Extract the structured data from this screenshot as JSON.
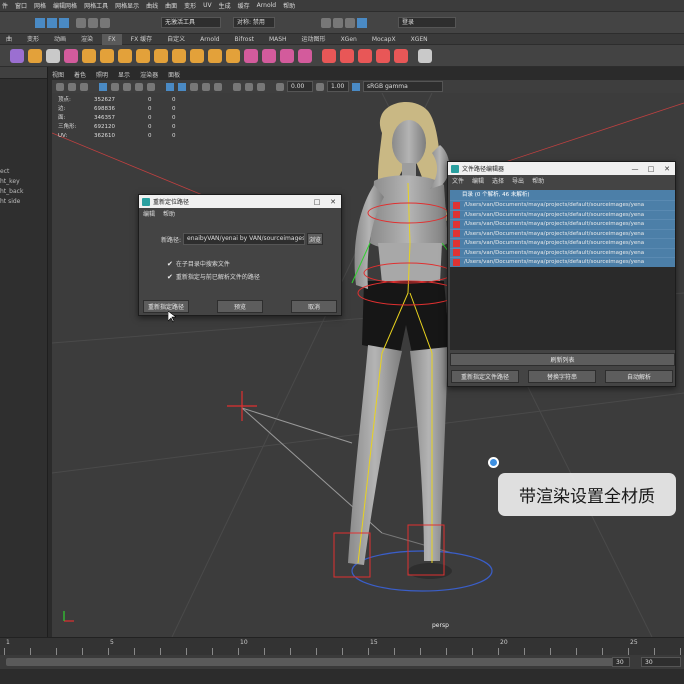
{
  "menubar": [
    "件",
    "窗口",
    "网格",
    "编辑网格",
    "网格工具",
    "网格显示",
    "曲线",
    "曲面",
    "变形",
    "UV",
    "生成",
    "缓存",
    "Arnold",
    "帮助"
  ],
  "statusline": {
    "selection_mode": "无激活工具",
    "symmetry": "对称: 禁用",
    "account": "登录"
  },
  "shelf_tabs": [
    {
      "label": "曲",
      "active": false
    },
    {
      "label": "变形",
      "active": false
    },
    {
      "label": "动画",
      "active": false
    },
    {
      "label": "渲染",
      "active": false
    },
    {
      "label": "FX",
      "active": true
    },
    {
      "label": "FX 缓存",
      "active": false
    },
    {
      "label": "自定义",
      "active": false
    },
    {
      "label": "Arnold",
      "active": false
    },
    {
      "label": "Bifrost",
      "active": false
    },
    {
      "label": "MASH",
      "active": false
    },
    {
      "label": "运动图形",
      "active": false
    },
    {
      "label": "XGen",
      "active": false
    },
    {
      "label": "MocapX",
      "active": false
    },
    {
      "label": "XGEN",
      "active": false
    }
  ],
  "outliner": {
    "items": [
      "ect",
      "ht_key",
      "ht_back",
      "ht side"
    ]
  },
  "viewport_menu": [
    "视图",
    "着色",
    "照明",
    "显示",
    "渲染器",
    "面板"
  ],
  "viewport_toolbar": {
    "field_a": "0.00",
    "field_b": "1.00",
    "color_space": "sRGB gamma"
  },
  "hud": {
    "rows": [
      {
        "k": "顶点:",
        "v1": "352627",
        "v2": "0",
        "v3": "0"
      },
      {
        "k": "边:",
        "v1": "698836",
        "v2": "0",
        "v3": "0"
      },
      {
        "k": "面:",
        "v1": "346357",
        "v2": "0",
        "v3": "0"
      },
      {
        "k": "三角形:",
        "v1": "692120",
        "v2": "0",
        "v3": "0"
      },
      {
        "k": "UV:",
        "v1": "362610",
        "v2": "0",
        "v3": "0"
      }
    ]
  },
  "camera_label": "persp",
  "path_dialog": {
    "title": "重新定位路径",
    "menu": [
      "编辑",
      "帮助"
    ],
    "new_path_label": "新路径:",
    "new_path_value": "enaibyVAN/yenai by VAN/sourceimages",
    "browse": "浏览",
    "check_subdir": "在子目录中搜索文件",
    "check_resolve": "重新指定与前已解析文件的路径",
    "btn_relocate": "重新指定路径",
    "btn_preview": "预览",
    "btn_cancel": "取消"
  },
  "file_dialog": {
    "title": "文件路径编辑器",
    "menu": [
      "文件",
      "编辑",
      "选择",
      "导出",
      "帮助"
    ],
    "summary": "目录 (0 个解析, 46 未解析)",
    "rows": [
      "/Users/van/Documents/maya/projects/default/sourceimages/yena",
      "/Users/van/Documents/maya/projects/default/sourceimages/yena",
      "/Users/van/Documents/maya/projects/default/sourceimages/yena",
      "/Users/van/Documents/maya/projects/default/sourceimages/yena",
      "/Users/van/Documents/maya/projects/default/sourceimages/yena",
      "/Users/van/Documents/maya/projects/default/sourceimages/yena",
      "/Users/van/Documents/maya/projects/default/sourceimages/yena"
    ],
    "btn_refresh": "刷新列表",
    "btn_relocate": "重新指定文件路径",
    "btn_replace": "替换字符串",
    "btn_resolve": "自动解析"
  },
  "caption": "带渲染设置全材质",
  "timeline": {
    "ticks": [
      "1",
      "5",
      "10",
      "15",
      "20",
      "25"
    ],
    "end_field": "30",
    "end_field2": "30"
  },
  "colors": {
    "maya_blue": "#4a8ac4",
    "dialog_bg": "#444444",
    "selection": "#4c7fa8",
    "caption_bg": "#eeeeee"
  }
}
